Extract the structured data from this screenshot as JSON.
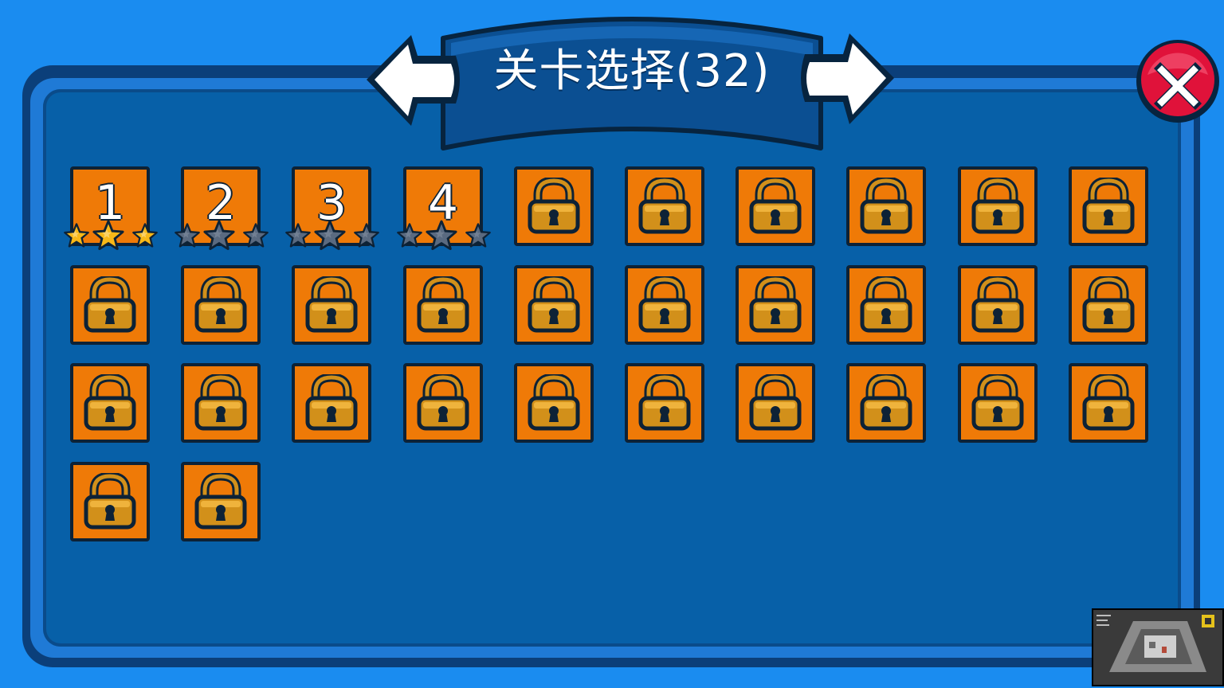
{
  "header": {
    "title": "关卡选择(32)",
    "prev_icon": "arrow-left-icon",
    "next_icon": "arrow-right-icon",
    "close_icon": "close-icon"
  },
  "colors": {
    "background": "#1a8cf0",
    "panel": "#0760a8",
    "tile": "#ef7a07",
    "star_earned": "#f8b818",
    "star_empty": "#5a6a80",
    "close": "#e0123a"
  },
  "levels": [
    {
      "label": "1",
      "locked": false,
      "stars": 3
    },
    {
      "label": "2",
      "locked": false,
      "stars": 0
    },
    {
      "label": "3",
      "locked": false,
      "stars": 0
    },
    {
      "label": "4",
      "locked": false,
      "stars": 0
    },
    {
      "label": "",
      "locked": true
    },
    {
      "label": "",
      "locked": true
    },
    {
      "label": "",
      "locked": true
    },
    {
      "label": "",
      "locked": true
    },
    {
      "label": "",
      "locked": true
    },
    {
      "label": "",
      "locked": true
    },
    {
      "label": "",
      "locked": true
    },
    {
      "label": "",
      "locked": true
    },
    {
      "label": "",
      "locked": true
    },
    {
      "label": "",
      "locked": true
    },
    {
      "label": "",
      "locked": true
    },
    {
      "label": "",
      "locked": true
    },
    {
      "label": "",
      "locked": true
    },
    {
      "label": "",
      "locked": true
    },
    {
      "label": "",
      "locked": true
    },
    {
      "label": "",
      "locked": true
    },
    {
      "label": "",
      "locked": true
    },
    {
      "label": "",
      "locked": true
    },
    {
      "label": "",
      "locked": true
    },
    {
      "label": "",
      "locked": true
    },
    {
      "label": "",
      "locked": true
    },
    {
      "label": "",
      "locked": true
    },
    {
      "label": "",
      "locked": true
    },
    {
      "label": "",
      "locked": true
    },
    {
      "label": "",
      "locked": true
    },
    {
      "label": "",
      "locked": true
    },
    {
      "label": "",
      "locked": true
    },
    {
      "label": "",
      "locked": true
    }
  ],
  "stars_max": 3
}
